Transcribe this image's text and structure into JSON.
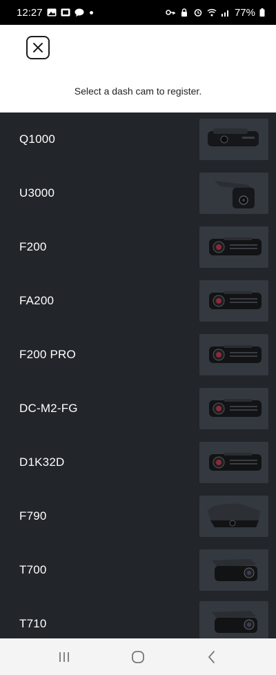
{
  "status_bar": {
    "time": "12:27",
    "battery": "77%",
    "left_icons": [
      "image-icon",
      "sim-icon",
      "chat-icon"
    ],
    "right_icons": [
      "key-icon",
      "lock-icon",
      "alarm-icon",
      "wifi-icon",
      "signal-icon",
      "battery-icon"
    ]
  },
  "header": {
    "close_icon": "close-icon",
    "instruction": "Select a dash cam to register."
  },
  "colors": {
    "list_background": "#22252a",
    "thumb_background": "#34383f",
    "status_bar": "#000000",
    "nav_bar": "#f4f4f4"
  },
  "dash_cams": [
    {
      "name": "Q1000",
      "image": "q1000-dashcam-image"
    },
    {
      "name": "U3000",
      "image": "u3000-dashcam-image"
    },
    {
      "name": "F200",
      "image": "f200-dashcam-image"
    },
    {
      "name": "FA200",
      "image": "fa200-dashcam-image"
    },
    {
      "name": "F200 PRO",
      "image": "f200pro-dashcam-image"
    },
    {
      "name": "DC-M2-FG",
      "image": "dcm2fg-dashcam-image"
    },
    {
      "name": "D1K32D",
      "image": "d1k32d-dashcam-image"
    },
    {
      "name": "F790",
      "image": "f790-dashcam-image"
    },
    {
      "name": "T700",
      "image": "t700-dashcam-image"
    },
    {
      "name": "T710",
      "image": "t710-dashcam-image"
    }
  ],
  "nav_bar": {
    "icons": [
      "recent-apps-icon",
      "home-icon",
      "back-icon"
    ]
  }
}
